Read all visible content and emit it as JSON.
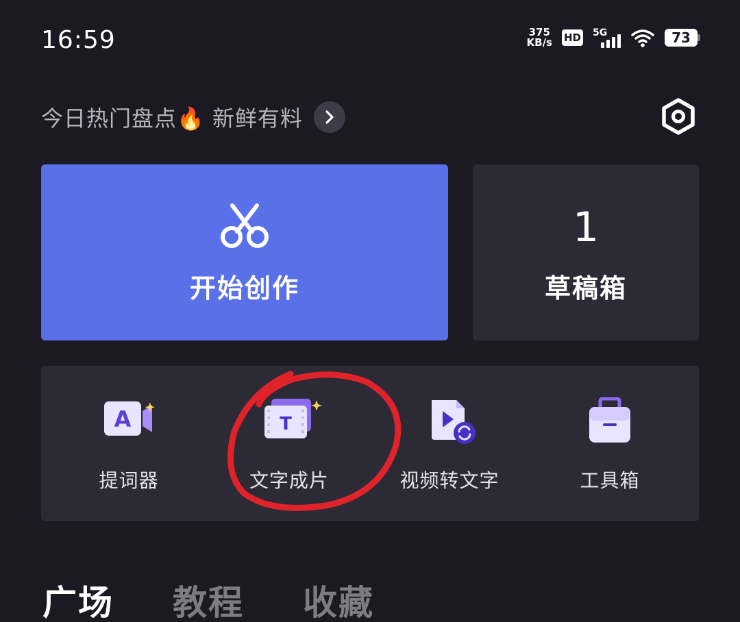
{
  "status_bar": {
    "time": "16:59",
    "net_speed_value": "375",
    "net_speed_unit": "KB/s",
    "hd_badge": "HD",
    "network": "5G",
    "battery": "73"
  },
  "banner": {
    "text": "今日热门盘点🔥 新鲜有料",
    "arrow_icon": "chevron-right-icon",
    "settings_icon": "settings-hexagon-icon"
  },
  "cards": {
    "create": {
      "label": "开始创作",
      "icon": "scissors-icon"
    },
    "drafts": {
      "count": "1",
      "label": "草稿箱"
    }
  },
  "tools": [
    {
      "label": "提词器",
      "icon": "teleprompter-icon"
    },
    {
      "label": "文字成片",
      "icon": "text-to-video-icon"
    },
    {
      "label": "视频转文字",
      "icon": "video-to-text-icon"
    },
    {
      "label": "工具箱",
      "icon": "toolbox-icon"
    }
  ],
  "tabs": [
    {
      "label": "广场",
      "active": true
    },
    {
      "label": "教程",
      "active": false
    },
    {
      "label": "收藏",
      "active": false
    }
  ],
  "colors": {
    "background": "#1b1a22",
    "accent": "#5970e8",
    "card": "#2b2a35",
    "annotation": "#e0222b"
  }
}
